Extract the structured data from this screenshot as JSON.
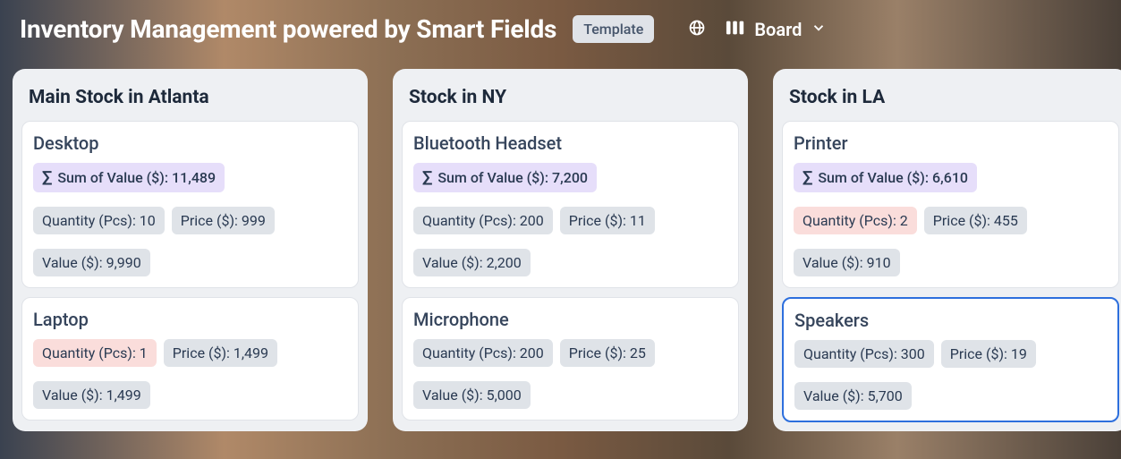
{
  "header": {
    "title": "Inventory Management powered by Smart Fields",
    "template_label": "Template",
    "view_label": "Board"
  },
  "labels": {
    "sum_prefix": "Sum of Value ($): ",
    "qty_prefix": "Quantity (Pcs): ",
    "price_prefix": "Price ($): ",
    "value_prefix": "Value ($): "
  },
  "columns": [
    {
      "title": "Main Stock in Atlanta",
      "cards": [
        {
          "title": "Desktop",
          "sum": "11,489",
          "qty": "10",
          "qty_warn": false,
          "price": "999",
          "value": "9,990",
          "selected": false
        },
        {
          "title": "Laptop",
          "sum": null,
          "qty": "1",
          "qty_warn": true,
          "price": "1,499",
          "value": "1,499",
          "selected": false
        }
      ]
    },
    {
      "title": "Stock in NY",
      "cards": [
        {
          "title": "Bluetooth Headset",
          "sum": "7,200",
          "qty": "200",
          "qty_warn": false,
          "price": "11",
          "value": "2,200",
          "selected": false
        },
        {
          "title": "Microphone",
          "sum": null,
          "qty": "200",
          "qty_warn": false,
          "price": "25",
          "value": "5,000",
          "selected": false
        }
      ]
    },
    {
      "title": "Stock in LA",
      "cards": [
        {
          "title": "Printer",
          "sum": "6,610",
          "qty": "2",
          "qty_warn": true,
          "price": "455",
          "value": "910",
          "selected": false
        },
        {
          "title": "Speakers",
          "sum": null,
          "qty": "300",
          "qty_warn": false,
          "price": "19",
          "value": "5,700",
          "selected": true
        }
      ]
    }
  ]
}
